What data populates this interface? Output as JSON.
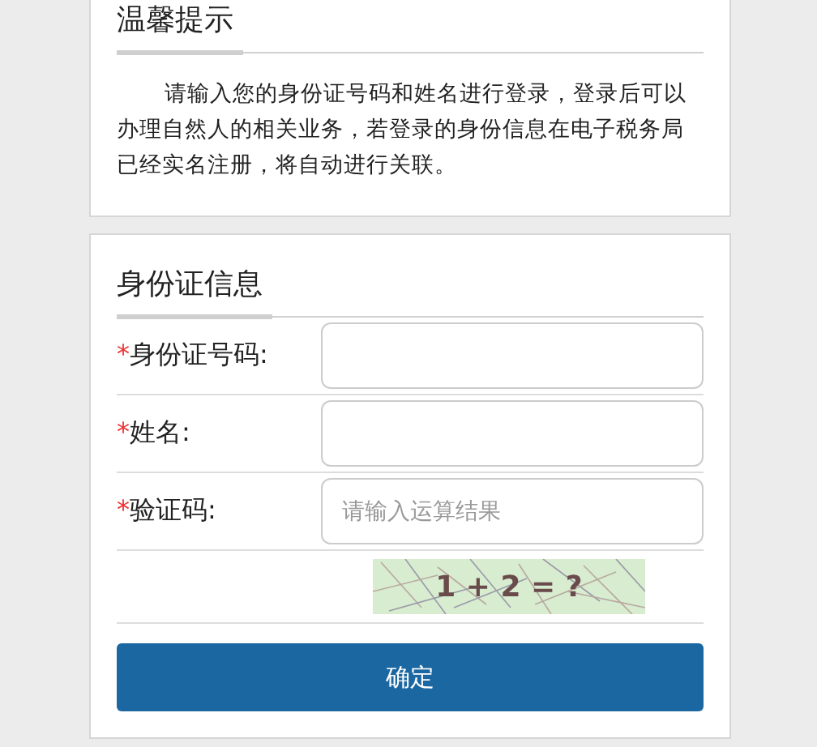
{
  "notice": {
    "title": "温馨提示",
    "text": "请输入您的身份证号码和姓名进行登录，登录后可以办理自然人的相关业务，若登录的身份信息在电子税务局已经实名注册，将自动进行关联。"
  },
  "form": {
    "title": "身份证信息",
    "fields": [
      {
        "mark": "*",
        "label": "身份证号码:"
      },
      {
        "mark": "*",
        "label": "姓名:"
      },
      {
        "mark": "*",
        "label": "验证码:",
        "placeholder": "请输入运算结果"
      }
    ],
    "captcha": {
      "text": "1 + 2 = ?"
    },
    "submit": "确定"
  }
}
